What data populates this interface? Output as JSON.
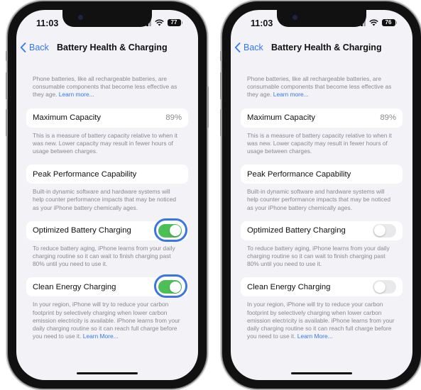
{
  "phones": [
    {
      "status": {
        "time": "11:03",
        "battery_level": "77"
      },
      "nav": {
        "back_label": "Back",
        "title": "Battery Health & Charging"
      },
      "intro": {
        "text": "Phone batteries, like all rechargeable batteries, are consumable components that become less effective as they age.",
        "link": "Learn more..."
      },
      "max_capacity": {
        "label": "Maximum Capacity",
        "value": "89%",
        "footer": "This is a measure of battery capacity relative to when it was new. Lower capacity may result in fewer hours of usage between charges."
      },
      "peak_performance": {
        "label": "Peak Performance Capability",
        "footer": "Built-in dynamic software and hardware systems will help counter performance impacts that may be noticed as your iPhone battery chemically ages."
      },
      "optimized_charging": {
        "label": "Optimized Battery Charging",
        "state": "on",
        "highlighted": true,
        "footer": "To reduce battery aging, iPhone learns from your daily charging routine so it can wait to finish charging past 80% until you need to use it."
      },
      "clean_energy": {
        "label": "Clean Energy Charging",
        "state": "on",
        "highlighted": true,
        "footer": "In your region, iPhone will try to reduce your carbon footprint by selectively charging when lower carbon emission electricity is available. iPhone learns from your daily charging routine so it can reach full charge before you need to use it.",
        "link": "Learn More..."
      }
    },
    {
      "status": {
        "time": "11:03",
        "battery_level": "76"
      },
      "nav": {
        "back_label": "Back",
        "title": "Battery Health & Charging"
      },
      "intro": {
        "text": "Phone batteries, like all rechargeable batteries, are consumable components that become less effective as they age.",
        "link": "Learn more..."
      },
      "max_capacity": {
        "label": "Maximum Capacity",
        "value": "89%",
        "footer": "This is a measure of battery capacity relative to when it was new. Lower capacity may result in fewer hours of usage between charges."
      },
      "peak_performance": {
        "label": "Peak Performance Capability",
        "footer": "Built-in dynamic software and hardware systems will help counter performance impacts that may be noticed as your iPhone battery chemically ages."
      },
      "optimized_charging": {
        "label": "Optimized Battery Charging",
        "state": "off",
        "highlighted": false,
        "footer": "To reduce battery aging, iPhone learns from your daily charging routine so it can wait to finish charging past 80% until you need to use it."
      },
      "clean_energy": {
        "label": "Clean Energy Charging",
        "state": "off",
        "highlighted": false,
        "footer": "In your region, iPhone will try to reduce your carbon footprint by selectively charging when lower carbon emission electricity is available. iPhone learns from your daily charging routine so it can reach full charge before you need to use it.",
        "link": "Learn More..."
      }
    }
  ],
  "colors": {
    "accent": "#3478f6",
    "toggle_on": "#4cbf55",
    "toggle_off": "#e9e9eb",
    "highlight_ring": "#3b76e0",
    "background": "#f2f2f7"
  }
}
